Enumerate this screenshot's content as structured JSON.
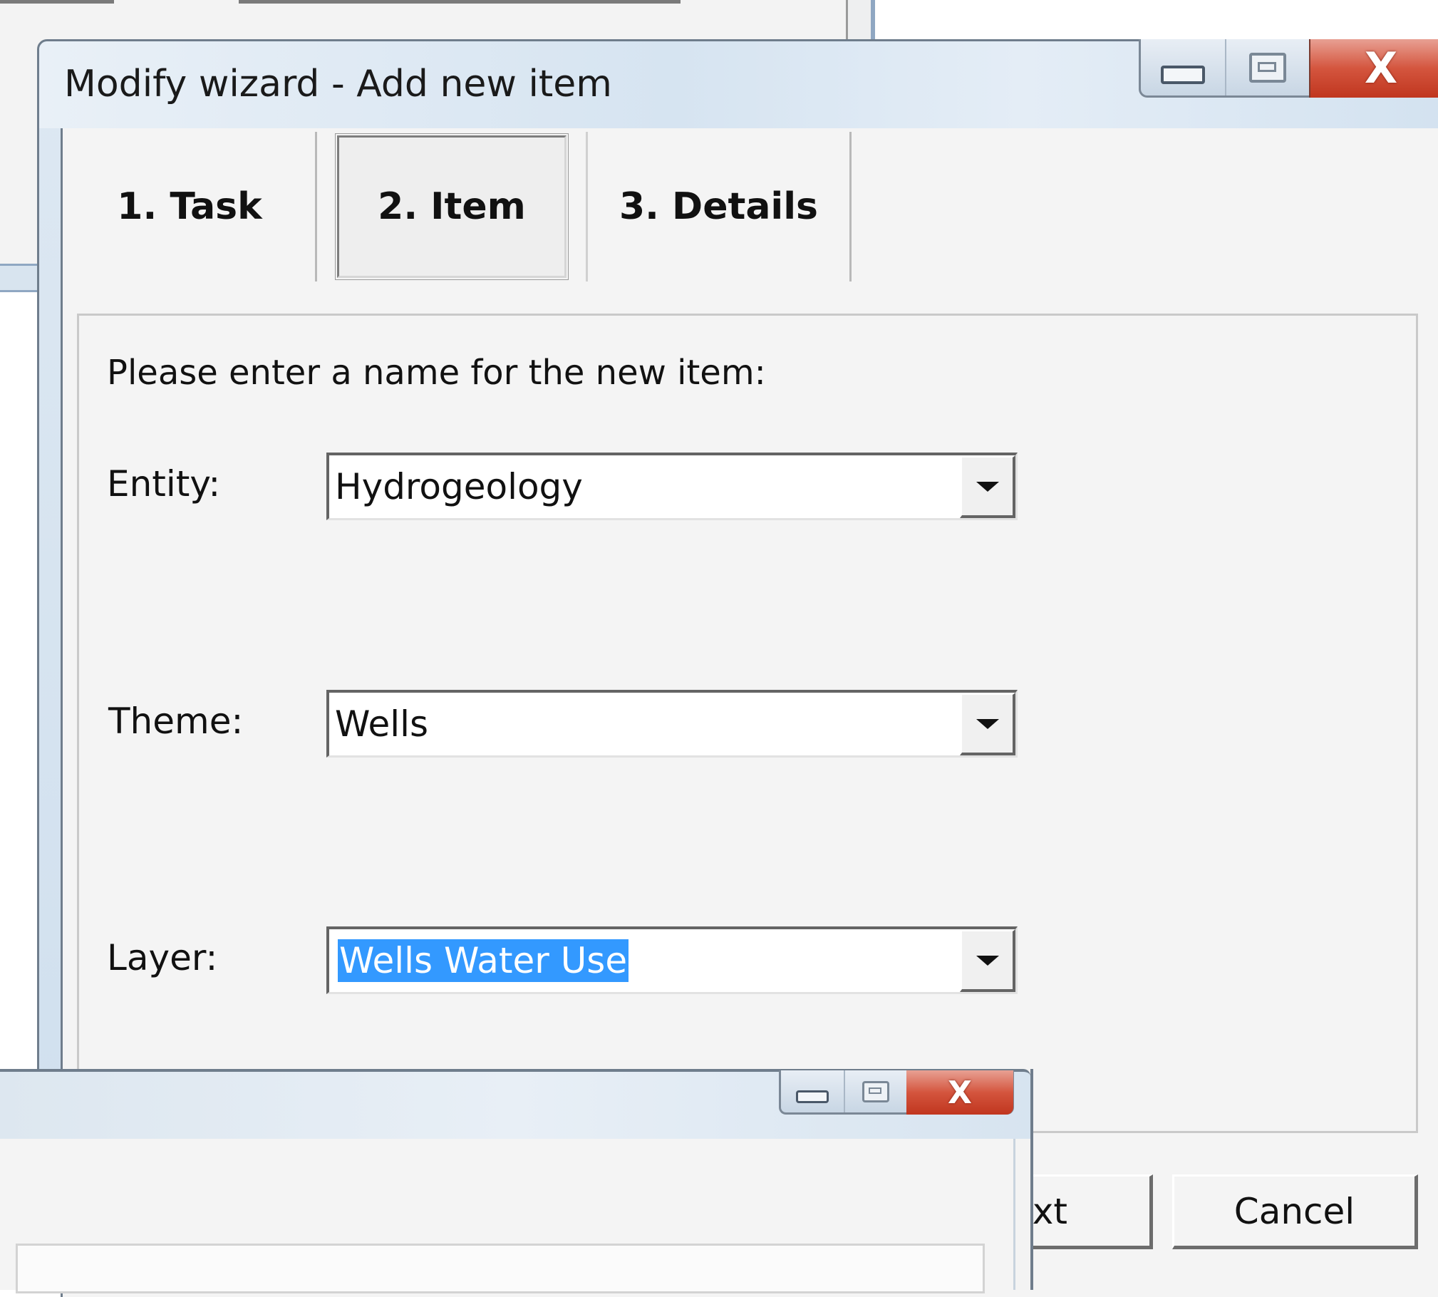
{
  "dialog": {
    "title": "Modify wizard - Add new item",
    "tabs": [
      {
        "label": "1. Task",
        "active": false
      },
      {
        "label": "2. Item",
        "active": true
      },
      {
        "label": "3. Details",
        "active": false
      }
    ],
    "instruction": "Please enter a name for the new item:",
    "fields": {
      "entity": {
        "label": "Entity:",
        "value": "Hydrogeology"
      },
      "theme": {
        "label": "Theme:",
        "value": "Wells"
      },
      "layer": {
        "label": "Layer:",
        "value": "Wells Water Use",
        "selected": true
      }
    },
    "buttons": {
      "next_partial": "xt",
      "cancel": "Cancel"
    },
    "caption_icons": [
      "minimize-icon",
      "maximize-icon",
      "close-icon"
    ]
  },
  "colors": {
    "selection": "#3399ff",
    "close_button": "#c8462f",
    "titlebar": "#d6e4f1",
    "client": "#f4f4f4"
  }
}
